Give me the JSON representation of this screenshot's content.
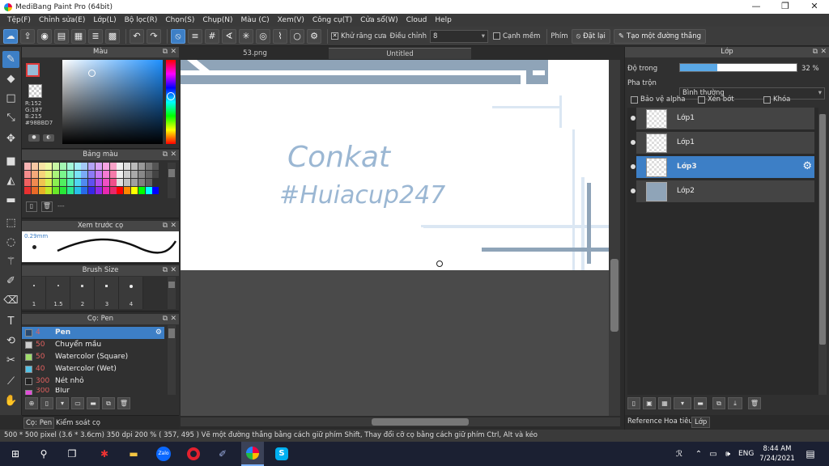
{
  "app": {
    "title": "MediBang Paint Pro (64bit)",
    "min": "—",
    "max": "❐",
    "close": "✕"
  },
  "menu": [
    "Tệp(F)",
    "Chỉnh sửa(E)",
    "Lớp(L)",
    "Bộ lọc(R)",
    "Chọn(S)",
    "Chụp(N)",
    "Màu (C)",
    "Xem(V)",
    "Công cụ(T)",
    "Cửa sổ(W)",
    "Cloud",
    "Help"
  ],
  "toolbar": {
    "antialias_label": "Khử răng cưa",
    "adjust_label": "Điều chỉnh",
    "adjust_value": "8",
    "snap_label": "Cạnh mềm",
    "key_label": "Phím",
    "reset_label": "Đặt lại",
    "line_label": "Tạo một đường thẳng"
  },
  "color_panel": {
    "title": "Màu",
    "r": "R:152",
    "g": "G:187",
    "b": "B:215",
    "hex": "#98BBD7"
  },
  "palette_panel": {
    "title": "Bảng màu",
    "extra": "---"
  },
  "preview_panel": {
    "title": "Xem trước cọ",
    "size_label": "0.29mm"
  },
  "brush_size_panel": {
    "title": "Brush Size",
    "sizes": [
      "1",
      "1.5",
      "2",
      "3",
      "4"
    ]
  },
  "brush_panel": {
    "title": "Cọ: Pen",
    "items": [
      {
        "size": "4",
        "name": "Pen",
        "color": "#3d7fc6"
      },
      {
        "size": "50",
        "name": "Chuyển mầu",
        "color": "#cccccc"
      },
      {
        "size": "50",
        "name": "Watercolor (Square)",
        "color": "#9fdc6b"
      },
      {
        "size": "40",
        "name": "Watercolor (Wet)",
        "color": "#54c2e6"
      },
      {
        "size": "300",
        "name": "Nét nhỏ",
        "color": "#222222"
      },
      {
        "size": "300",
        "name": "Blur",
        "color": "#e04ed8"
      }
    ]
  },
  "left_tabs": {
    "pen": "Cọ: Pen",
    "check": "Kiểm soát cọ"
  },
  "canvas_tabs": [
    "53.png",
    "Untitled"
  ],
  "canvas_text": {
    "line1": "Conkat",
    "line2": "#Huiacup247"
  },
  "layer_panel": {
    "title": "Lớp",
    "opacity_label": "Độ trong",
    "opacity_value": "32 %",
    "opacity": 0.32,
    "blend_label": "Pha trộn",
    "blend_value": "Bình thường",
    "protect_alpha": "Bảo vệ alpha",
    "clipping": "Xén bớt",
    "lock": "Khóa",
    "layers": [
      {
        "name": "Lớp1"
      },
      {
        "name": "Lớp1"
      },
      {
        "name": "Lớp3",
        "selected": true
      },
      {
        "name": "Lớp2"
      }
    ],
    "tabs": [
      "Reference",
      "Hoa tiêu",
      "Lớp"
    ]
  },
  "status": "500 * 500 pixel   (3.6 * 3.6cm)   350 dpi   200 %   ( 357, 495 )   Vẽ một đường thẳng bằng cách giữ phím Shift, Thay đổi cỡ cọ bằng cách giữ phím Ctrl, Alt và kéo",
  "taskbar": {
    "lang": "ENG",
    "time": "8:44 AM",
    "date": "7/24/2021"
  }
}
